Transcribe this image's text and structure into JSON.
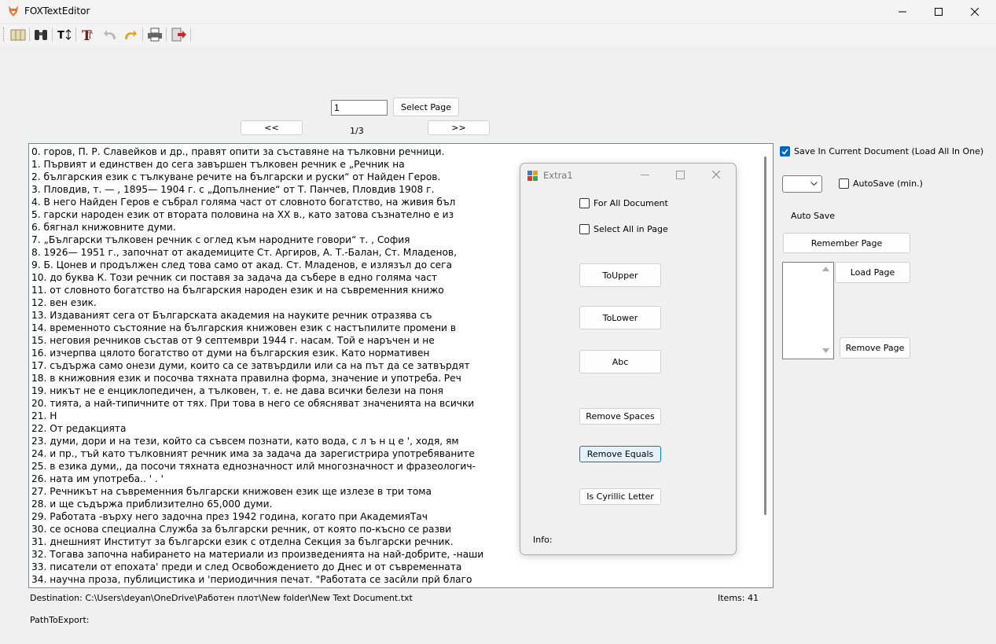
{
  "window": {
    "title": "FOXTextEditor"
  },
  "toolbar": {
    "items": [
      "open-icon",
      "find-icon",
      "text-size-icon",
      "font-icon",
      "undo-icon",
      "redo-icon",
      "print-icon",
      "exit-icon"
    ]
  },
  "nav": {
    "page_input": "1",
    "select_page": "Select Page",
    "prev": "<<",
    "next": ">>",
    "page_indicator": "1/3"
  },
  "editor": {
    "lines": [
      "0. горов, П. Р. Славейков и др., правят опити за съставяне на тълковни речници.",
      "1. Първият и единствен до сега завършен тълковен речник е „Речник на",
      "2. българския език с тълкуване речите на български и руски“ от Найден Геров.",
      "3. Пловдив, т. — , 1895— 1904 г. с „Допълнение“ от Т. Панчев, Пловдив 1908 г.",
      "4. В него Найден Геров е събрал голяма част от словното богатство, на живия бъл",
      "5. гарски народен език от втората половина на XX в., като затова съзнателно е из",
      "6. бягнал книжовните думи.",
      "7. „Български тълковен речник с оглед към народните говори“ т. , София",
      "8. 1926— 1951 г., започнат от академиците Ст. Аргиров, А. Т.-Балан, Ст. Младенов,",
      "9. Б. Цонев и продължен след това само от акад. Ст. Младенов, е излязъл до сега",
      "10. до буква К. Този речник си поставя за задача да събере в едно голяма част",
      "11. от словното богатство на българския народен език и на съвременния книжо",
      "12. вен език.",
      "13. Издаваният сега от Българската академия на науките речник отразява съ",
      "14. временното състояние на българския книжовен език с настъпилите промени в",
      "15. неговия речников състав от 9 септември 1944 г. насам. Той е наръчен и не",
      "16. изчерпва цялото богатство от думи на българския език. Като нормативен",
      "17. съдържа само онези думи, които са се затвърдили или са на път да се затвърдят",
      "18. в книжовния език и посочва тяхната правилна форма, значение и употреба. Реч",
      "19. никът не е енциклопедичен, а тълковен, т. е. не дава всички белези на поня",
      "20. тията, а най-типичните от тях. При това в него се обясняват значенията на всички",
      "21. Н",
      "22. От редакцията",
      "23. думи, дори и на тези, който са съвсем познати, като вода, с л ъ н ц е ', ходя, ям",
      "24. и пр., тъй като тълковният речник има за задача да зарегистрира употребяваните",
      "25. в езика думи,, да посочи тяхната еднозначност илй многозначност и фразеологич-",
      "26. ната им употреба.. ' . '",
      "27. Речникът на съвременния български книжовен език ще излезе в три тома",
      "28. и ще съдържа приблизително 65,000 думи.",
      "29. Работата -върху него задочна през 1942 година, когато при АкадемияТач",
      "30. се основа специална Служба за български речник, от която по-късно се разви",
      "31. днешният Институт за български език с отделна Секция за български речник.",
      "32. Тогава започна набирането на материали из произведенията на най-добрите, -наши",
      "33. писатели от епохата' преди и след Освобождението до Днес и от съвременната",
      "34. научна проза, публицистика и 'периодичния печат. \"Работата се засйли прй благо"
    ]
  },
  "dialog": {
    "title": "Extra1",
    "for_all_document": "For All Document",
    "select_all_in_page": "Select All in Page",
    "to_upper": "ToUpper",
    "to_lower": "ToLower",
    "abc": "Abc",
    "remove_spaces": "Remove Spaces",
    "remove_equals": "Remove Equals",
    "is_cyrillic": "Is Cyrillic Letter",
    "info_label": "Info:"
  },
  "side": {
    "save_in_current": "Save In Current Document (Load All In One)",
    "save_in_current_checked": true,
    "autosave_label": "AutoSave (min.)",
    "autosave_checked": false,
    "autosave_status": "Auto Save",
    "remember_page": "Remember Page",
    "load_page": "Load Page",
    "remove_page": "Remove Page"
  },
  "status": {
    "destination": "Destination: C:\\Users\\deyan\\OneDrive\\Работен плот\\New folder\\New Text Document.txt",
    "items": "Items: 41",
    "path_to_export": "PathToExport:"
  },
  "colors": {
    "accent": "#0067c0",
    "focus_border": "#0078d7"
  }
}
